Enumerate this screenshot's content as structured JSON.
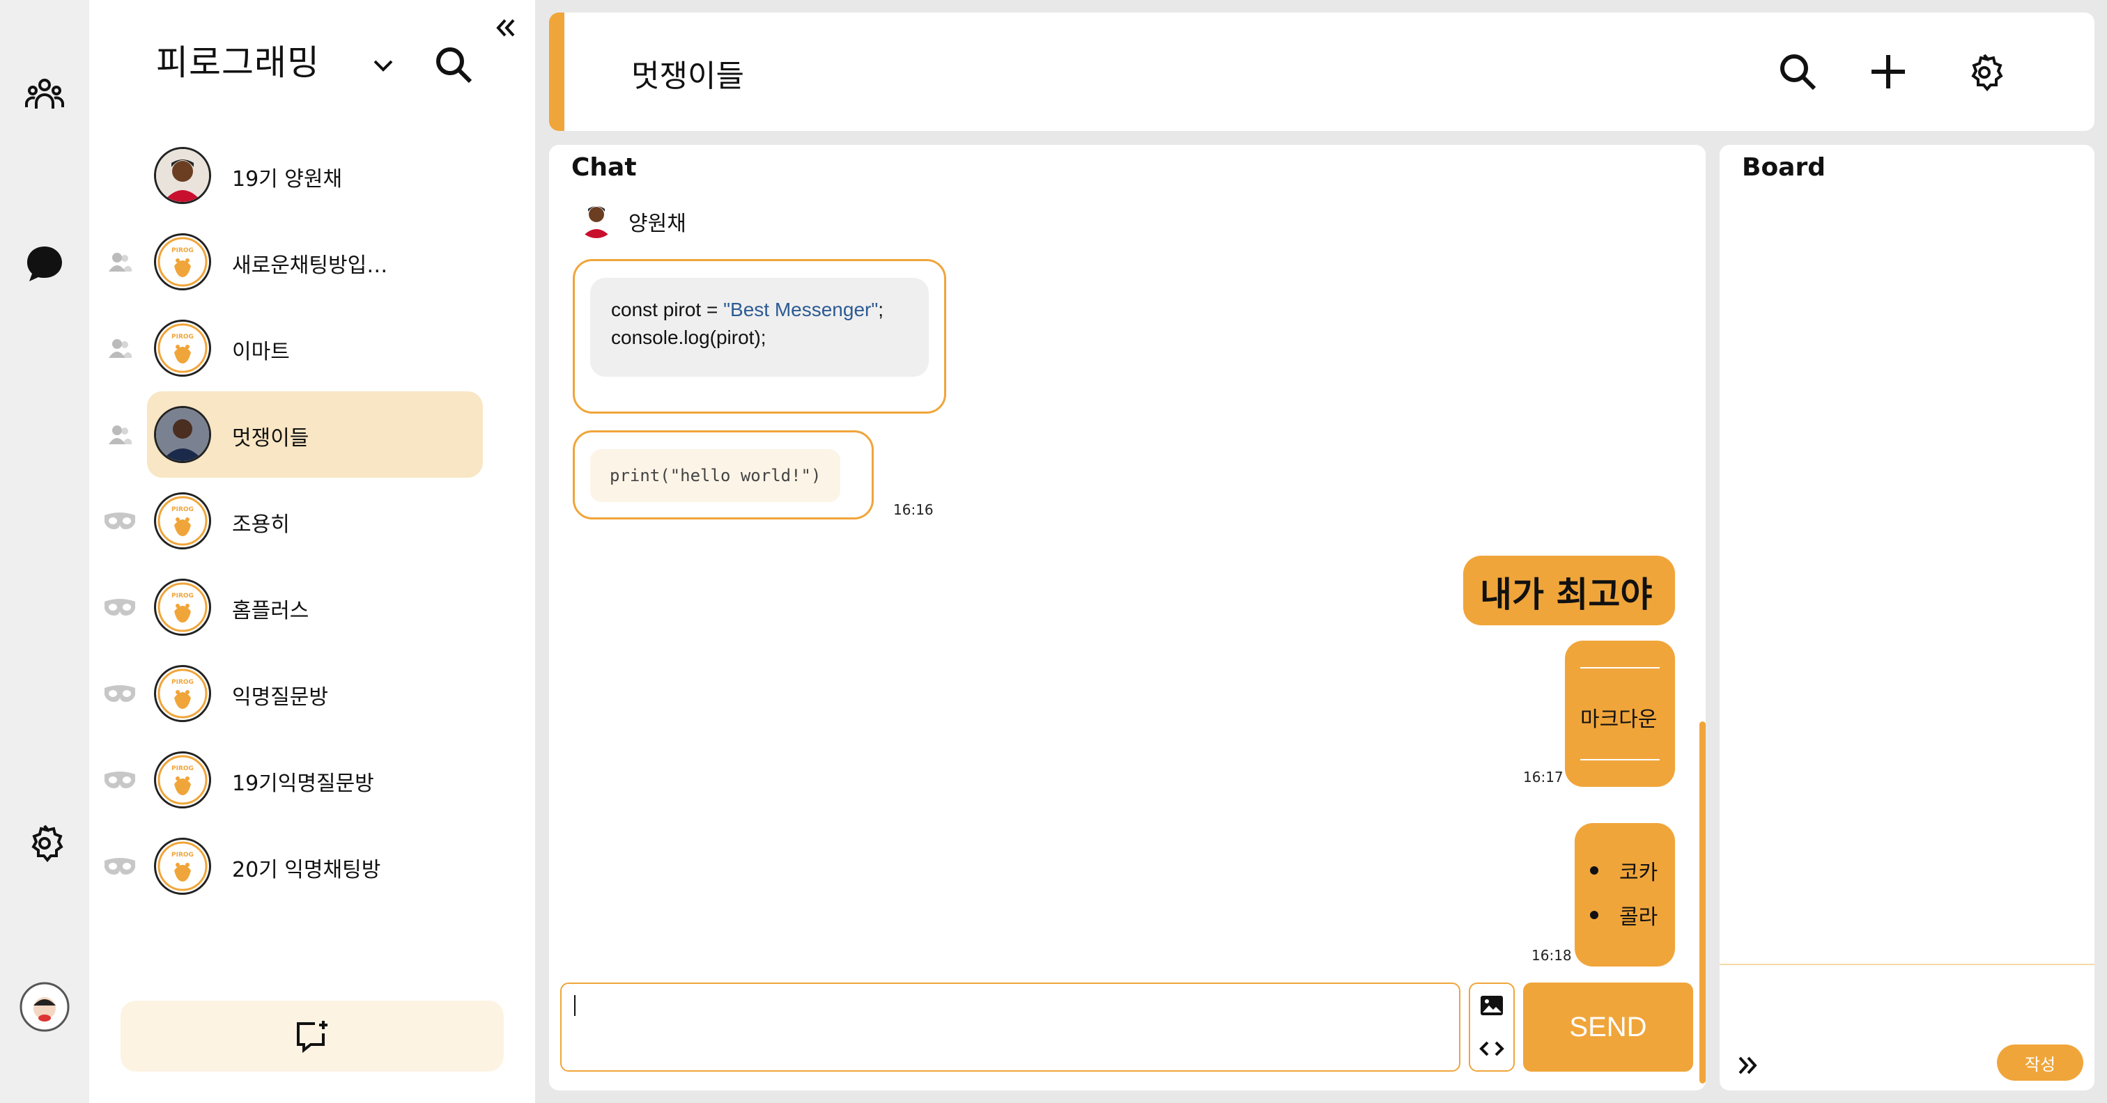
{
  "workspace": {
    "name": "피로그래밍"
  },
  "rooms": [
    {
      "name": "19기 양원채",
      "type": "dm"
    },
    {
      "name": "새로운채팅방입…",
      "type": "group"
    },
    {
      "name": "이마트",
      "type": "group"
    },
    {
      "name": "멋쟁이들",
      "type": "group",
      "active": true
    },
    {
      "name": "조용히",
      "type": "anonymous"
    },
    {
      "name": "홈플러스",
      "type": "anonymous"
    },
    {
      "name": "익명질문방",
      "type": "anonymous"
    },
    {
      "name": "19기익명질문방",
      "type": "anonymous"
    },
    {
      "name": "20기 익명채팅방",
      "type": "anonymous"
    }
  ],
  "header": {
    "title": "멋쟁이들"
  },
  "chat": {
    "title": "Chat",
    "sender": "양원채",
    "code_block": {
      "line1_a": "const pirot = ",
      "line1_str": "\"Best Messenger\"",
      "line1_b": ";",
      "line2": "console.log(pirot);"
    },
    "inline_code": "print(\"hello world!\")",
    "inline_code_time": "16:16",
    "my_msg_heading": "내가 최고야",
    "my_msg_markdown": "마크다운",
    "my_msg_markdown_time": "16:17",
    "my_msg_list": [
      "코카",
      "콜라"
    ],
    "my_msg_list_time": "16:18",
    "send_label": "SEND"
  },
  "board": {
    "title": "Board",
    "write_label": "작성"
  },
  "colors": {
    "accent": "#f0a53a",
    "active_room": "#f8e6c4"
  }
}
